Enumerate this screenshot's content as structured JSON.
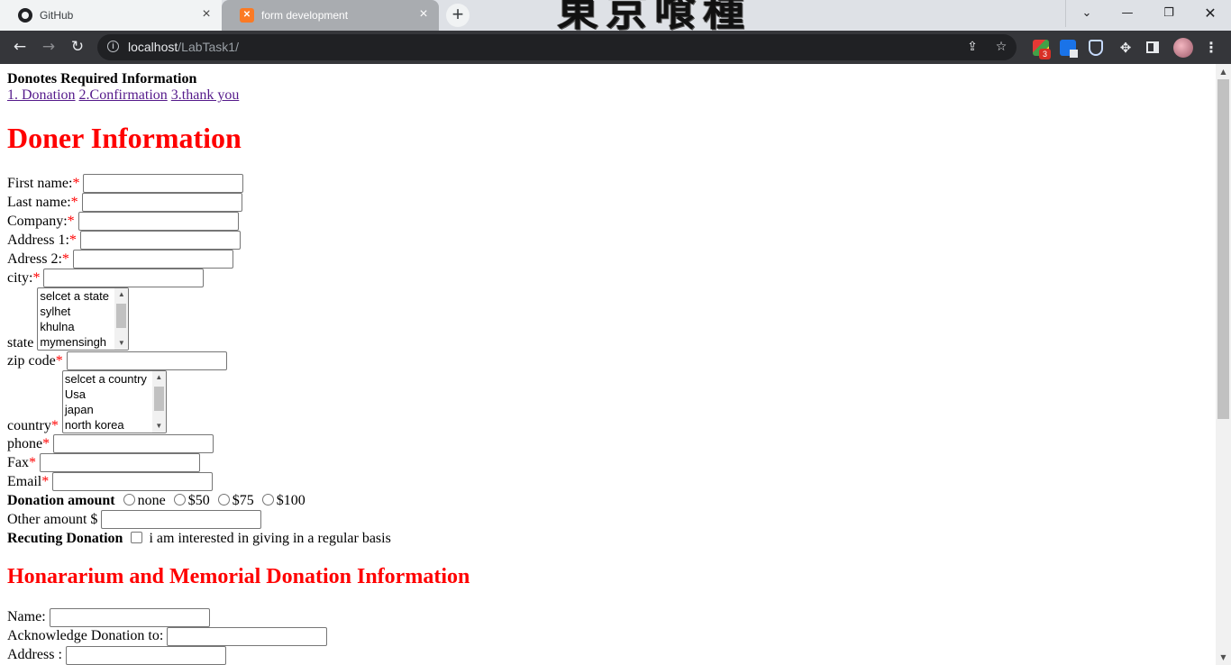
{
  "browser": {
    "tabs": [
      {
        "title": "GitHub",
        "icon": "github-icon",
        "active": false
      },
      {
        "title": "form development",
        "icon": "xampp-icon",
        "active": true
      }
    ],
    "url_host": "localhost",
    "url_path": "/LabTask1/",
    "extension_badge": "3"
  },
  "page": {
    "required_note": "Donotes Required Information",
    "steps": [
      "1. Donation",
      "2.Confirmation",
      "3.thank you"
    ],
    "heading": "Doner Information",
    "required_mark": "*",
    "fields": {
      "first_name": "First name:",
      "last_name": "Last name:",
      "company": "Company:",
      "address1": "Address 1:",
      "address2": "Adress 2:",
      "city": "city:",
      "state": "state",
      "zip": "zip code",
      "country": "country",
      "phone": "phone",
      "fax": "Fax",
      "email": "Email"
    },
    "state_options": [
      "selcet a state",
      "sylhet",
      "khulna",
      "mymensingh"
    ],
    "country_options": [
      "selcet a country",
      "Usa",
      "japan",
      "north korea"
    ],
    "donation_amount_label": "Donation amount",
    "donation_options": [
      "none",
      "$50",
      "$75",
      "$100"
    ],
    "other_amount_label": "Other amount $",
    "recurring_label": "Recuting Donation",
    "recurring_text": "i am interested in giving in a regular basis",
    "honorarium_heading": "Honararium and Memorial Donation Information",
    "hon_fields": {
      "name": "Name:",
      "acknowledge": "Acknowledge Donation to:",
      "address": "Address :"
    }
  }
}
